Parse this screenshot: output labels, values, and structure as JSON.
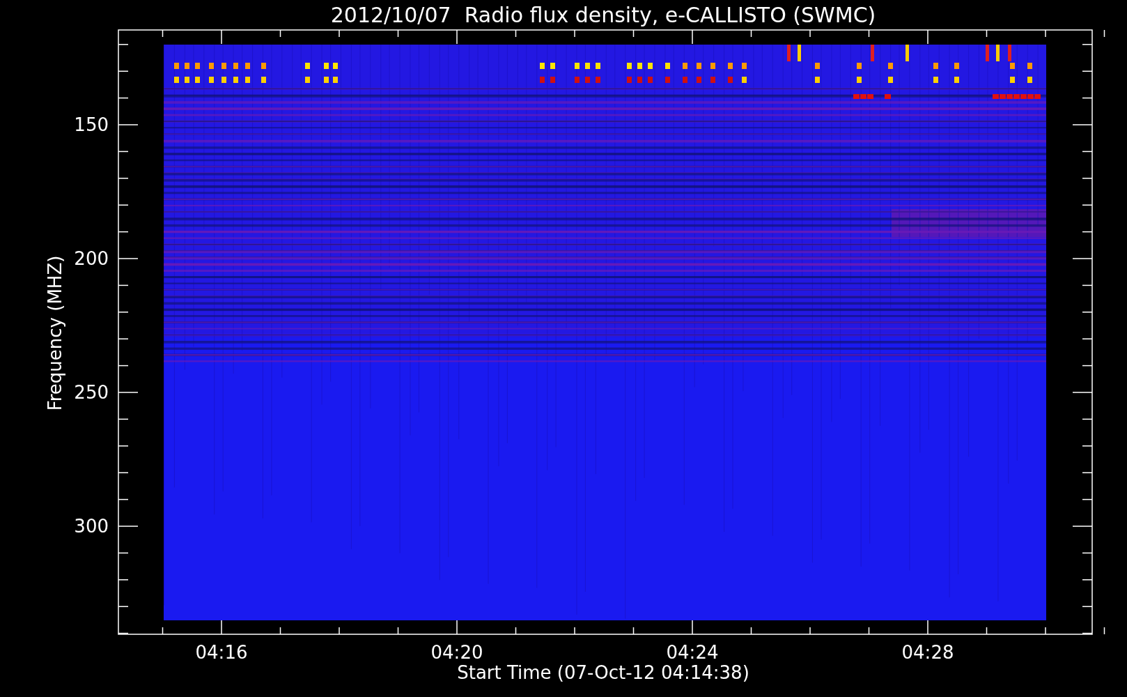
{
  "title": "2012/10/07  Radio flux density, e-CALLISTO (SWMC)",
  "xlabel": "Start Time (07-Oct-12 04:14:38)",
  "ylabel": "Frequency (MHZ)",
  "xticks": [
    "04:16",
    "04:20",
    "04:24",
    "04:28"
  ],
  "yticks": [
    "150",
    "200",
    "250",
    "300"
  ]
}
